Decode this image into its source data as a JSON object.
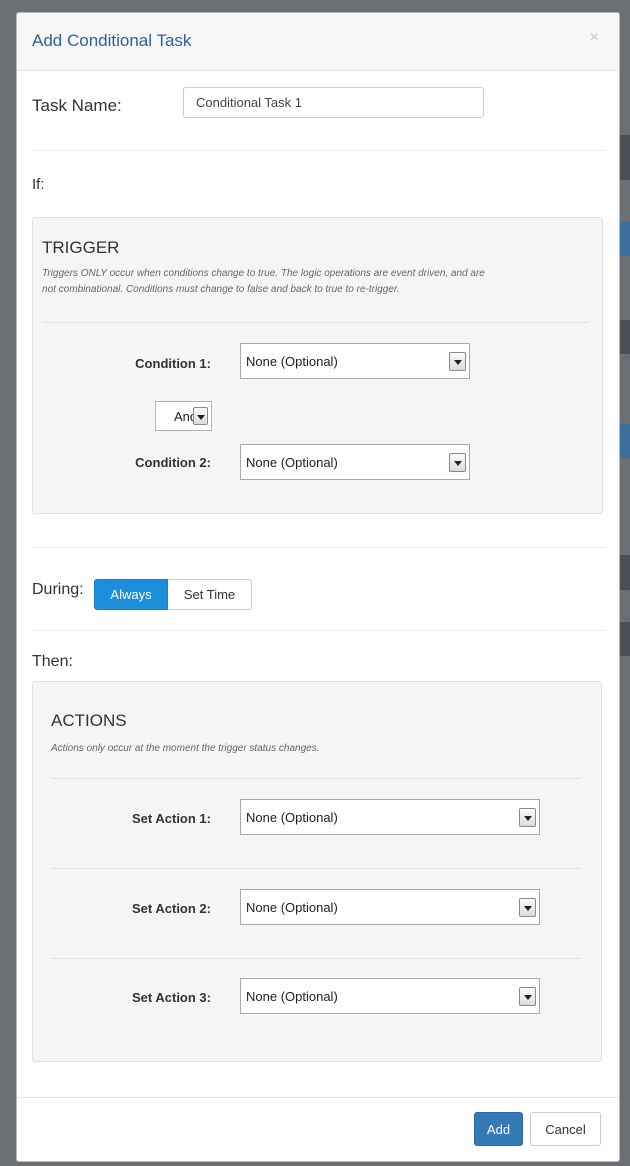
{
  "modal": {
    "title": "Add Conditional Task",
    "close_glyph": "×"
  },
  "task_name": {
    "label": "Task Name:",
    "value": "Conditional Task 1"
  },
  "if_section": {
    "label": "If:"
  },
  "trigger": {
    "title": "TRIGGER",
    "help_line1": "Triggers ONLY occur when conditions change to true. The logic operations are event driven, and are",
    "help_line2": "not combinational. Conditions must change to false and back to true to re-trigger.",
    "condition1": {
      "label": "Condition 1:",
      "value": "None (Optional)"
    },
    "operator": {
      "value": "And"
    },
    "condition2": {
      "label": "Condition 2:",
      "value": "None (Optional)"
    }
  },
  "during": {
    "label": "During:",
    "options": [
      "Always",
      "Set Time"
    ],
    "selected": "Always"
  },
  "then_section": {
    "label": "Then:"
  },
  "actions": {
    "title": "ACTIONS",
    "help": "Actions only occur at the moment the trigger status changes.",
    "items": [
      {
        "label": "Set Action 1:",
        "value": "None (Optional)"
      },
      {
        "label": "Set Action 2:",
        "value": "None (Optional)"
      },
      {
        "label": "Set Action 3:",
        "value": "None (Optional)"
      }
    ]
  },
  "footer": {
    "add_label": "Add",
    "cancel_label": "Cancel"
  },
  "colors": {
    "accent": "#1b8fdc",
    "primary": "#337ab7",
    "title": "#2f5f9a"
  }
}
